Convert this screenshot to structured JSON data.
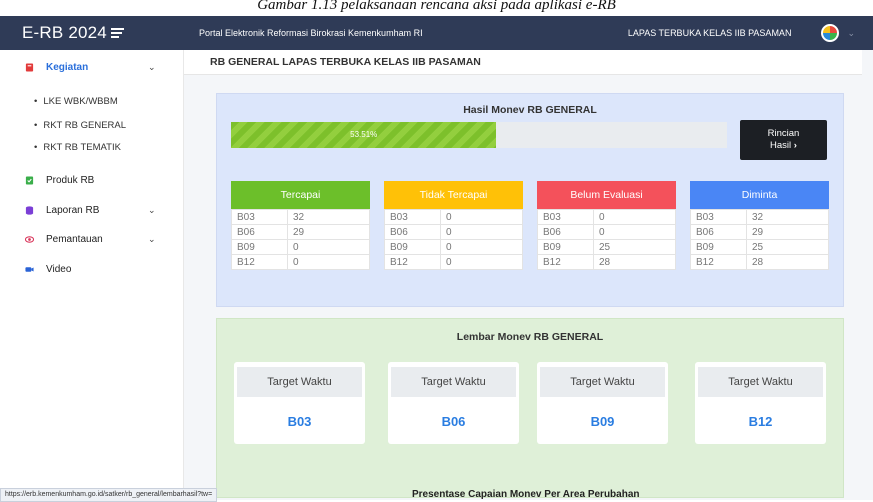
{
  "caption": "Gambar 1.13 pelaksanaan rencana aksi pada aplikasi e-RB",
  "app": {
    "brand": "E-RB 2024"
  },
  "header": {
    "portal_title": "Portal Elektronik Reformasi Birokrasi Kemenkumham RI",
    "unit_name": "LAPAS TERBUKA KELAS IIB PASAMAN"
  },
  "sidebar": {
    "items": [
      {
        "label": "Kegiatan",
        "icon": "book-icon"
      },
      {
        "label": "Produk RB",
        "icon": "document-icon"
      },
      {
        "label": "Laporan RB",
        "icon": "database-icon"
      },
      {
        "label": "Pemantauan",
        "icon": "eye-icon"
      },
      {
        "label": "Video",
        "icon": "video-icon"
      }
    ],
    "subitems": [
      "LKE WBK/WBBM",
      "RKT RB GENERAL",
      "RKT RB TEMATIK"
    ]
  },
  "page": {
    "title": "RB GENERAL LAPAS TERBUKA KELAS IIB PASAMAN"
  },
  "hasil": {
    "title": "Hasil Monev RB GENERAL",
    "progress_label": "53.51%",
    "progress_value": 0.5351,
    "button_line1": "Rincian",
    "button_line2": "Hasil",
    "cards": [
      {
        "title": "Tercapai",
        "color": "#6cbf2a",
        "rows": [
          [
            "B03",
            "32"
          ],
          [
            "B06",
            "29"
          ],
          [
            "B09",
            "0"
          ],
          [
            "B12",
            "0"
          ]
        ]
      },
      {
        "title": "Tidak Tercapai",
        "color": "#ffc107",
        "rows": [
          [
            "B03",
            "0"
          ],
          [
            "B06",
            "0"
          ],
          [
            "B09",
            "0"
          ],
          [
            "B12",
            "0"
          ]
        ]
      },
      {
        "title": "Belum Evaluasi",
        "color": "#f4515b",
        "rows": [
          [
            "B03",
            "0"
          ],
          [
            "B06",
            "0"
          ],
          [
            "B09",
            "25"
          ],
          [
            "B12",
            "28"
          ]
        ]
      },
      {
        "title": "Diminta",
        "color": "#4a86f5",
        "rows": [
          [
            "B03",
            "32"
          ],
          [
            "B06",
            "29"
          ],
          [
            "B09",
            "25"
          ],
          [
            "B12",
            "28"
          ]
        ]
      }
    ]
  },
  "lembar": {
    "title": "Lembar Monev RB GENERAL",
    "cards": [
      {
        "label": "Target Waktu",
        "value": "B03"
      },
      {
        "label": "Target Waktu",
        "value": "B06"
      },
      {
        "label": "Target Waktu",
        "value": "B09"
      },
      {
        "label": "Target Waktu",
        "value": "B12"
      }
    ]
  },
  "status_url": "https://erb.kemenkumham.go.id/satker/rb_general/lembarhasil?tw=",
  "bottom_title": "Presentase Capaian Monev Per Area Perubahan"
}
